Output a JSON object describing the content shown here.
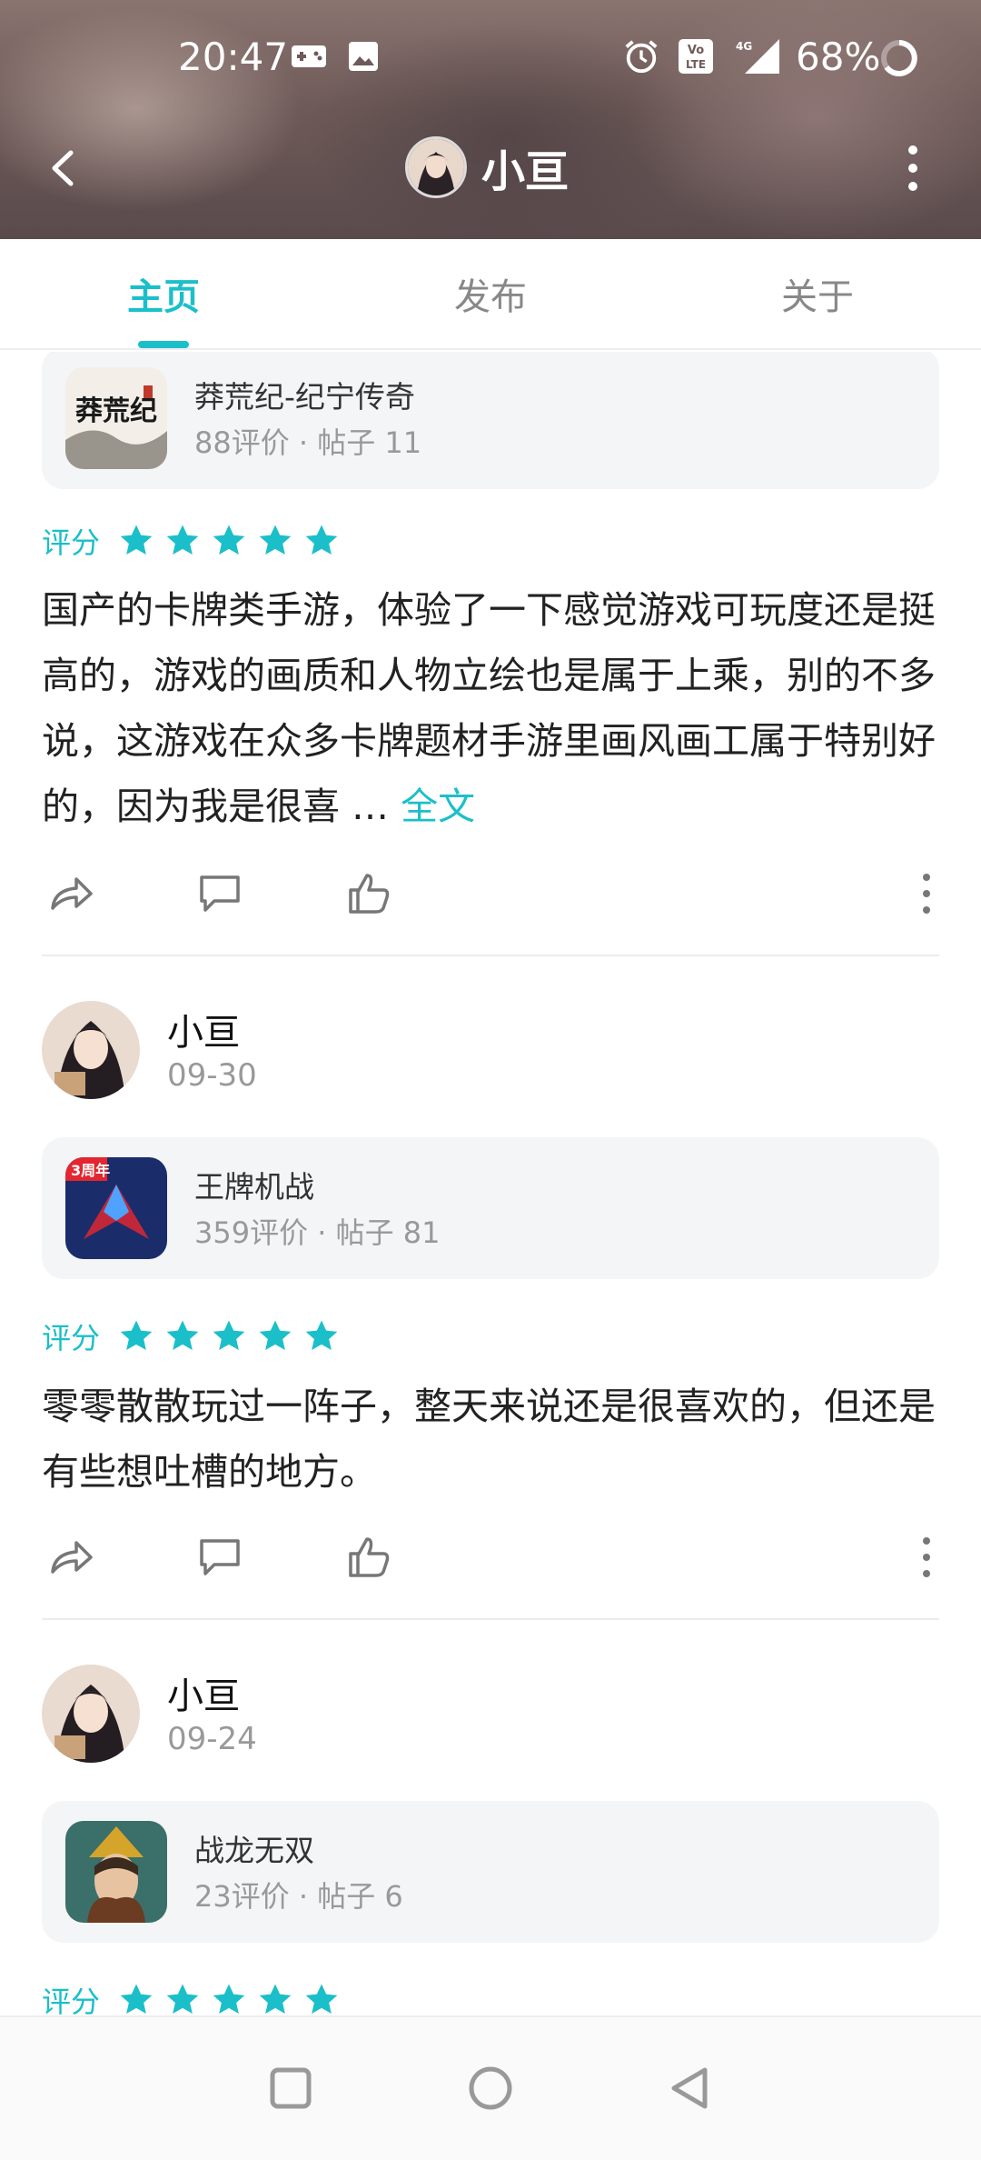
{
  "status_bar": {
    "time": "20:47",
    "battery": "68%",
    "icons": [
      "gamepad-icon",
      "image-icon",
      "alarm-icon",
      "volte-icon",
      "signal-4g-icon",
      "battery-icon"
    ]
  },
  "header": {
    "title": "小亘",
    "icons": [
      "back-arrow-icon",
      "avatar",
      "more-vertical-icon"
    ]
  },
  "tabs": [
    {
      "label": "主页",
      "active": true
    },
    {
      "label": "发布",
      "active": false
    },
    {
      "label": "关于",
      "active": false
    }
  ],
  "posts": [
    {
      "game": {
        "name": "莽荒纪-纪宁传奇",
        "meta": "88评价 · 帖子 11"
      },
      "score_label": "评分",
      "stars": 5,
      "text": "国产的卡牌类手游，体验了一下感觉游戏可玩度还是挺高的，游戏的画质和人物立绘也是属于上乘，别的不多说，这游戏在众多卡牌题材手游里画风画工属于特别好的，因为我是很喜 …",
      "more_label": "全文"
    },
    {
      "author": "小亘",
      "date": "09-30",
      "game": {
        "name": "王牌机战",
        "meta": "359评价 · 帖子 81"
      },
      "score_label": "评分",
      "stars": 5,
      "text": "零零散散玩过一阵子，整天来说还是很喜欢的，但还是有些想吐槽的地方。"
    },
    {
      "author": "小亘",
      "date": "09-24",
      "game": {
        "name": "战龙无双",
        "meta": "23评价 · 帖子 6"
      },
      "score_label": "评分",
      "stars": 5
    }
  ],
  "colors": {
    "accent": "#1bbfc9",
    "text": "#222222",
    "muted": "#999999",
    "card_bg": "#f4f5f7"
  }
}
